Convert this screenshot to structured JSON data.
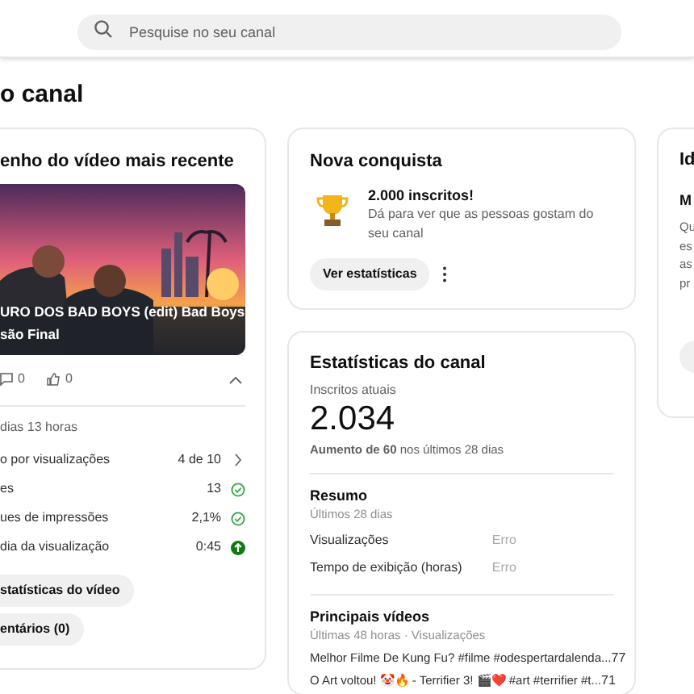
{
  "search": {
    "placeholder": "Pesquise no seu canal"
  },
  "page_title": "o canal",
  "latest_video": {
    "title": "enho do vídeo mais recente",
    "video_title": [
      "URO DOS BAD BOYS (edit) Bad Boys",
      "são Final"
    ],
    "comments": "0",
    "likes": "0",
    "expanded": true,
    "age": "dias 13 horas",
    "metrics": [
      {
        "label": "o por visualizações",
        "value": "4 de 10",
        "kind": "link"
      },
      {
        "label": "es",
        "value": "13",
        "kind": "check"
      },
      {
        "label": "ues de impressões",
        "value": "2,1%",
        "kind": "check"
      },
      {
        "label": "dia da visualização",
        "value": "0:45",
        "kind": "up"
      }
    ],
    "buttons": [
      "statísticas do vídeo",
      "entários (0)"
    ]
  },
  "achievement": {
    "title": "Nova conquista",
    "headline": "2.000 inscritos!",
    "description": "Dá para ver que as pessoas gostam do seu canal",
    "button": "Ver estatísticas"
  },
  "channel_stats": {
    "title": "Estatísticas do canal",
    "subscribers_label": "Inscritos atuais",
    "subscribers": "2.034",
    "change": "**Aumento de 60** nos últimos 28 dias",
    "summary": {
      "title": "Resumo",
      "period": "Últimos 28 dias",
      "rows": [
        {
          "label": "Visualizações",
          "value": "Erro"
        },
        {
          "label": "Tempo de exibição (horas)",
          "value": "Erro"
        }
      ]
    },
    "top_videos": {
      "title": "Principais vídeos",
      "period": "Últimas 48 horas · Visualizações",
      "rows": [
        {
          "title": "Melhor Filme De Kung Fu? #filme #odespertardalenda...",
          "views": "77"
        },
        {
          "title": "O Art voltou! 🤡🔥 - Terrifier 3! 🎬❤️ #art #terrifier #t...",
          "views": "71"
        }
      ]
    }
  },
  "ideas": {
    "title": "Id",
    "subtitle": "M",
    "lines": [
      "Qu",
      "es",
      "as",
      "pr"
    ]
  }
}
